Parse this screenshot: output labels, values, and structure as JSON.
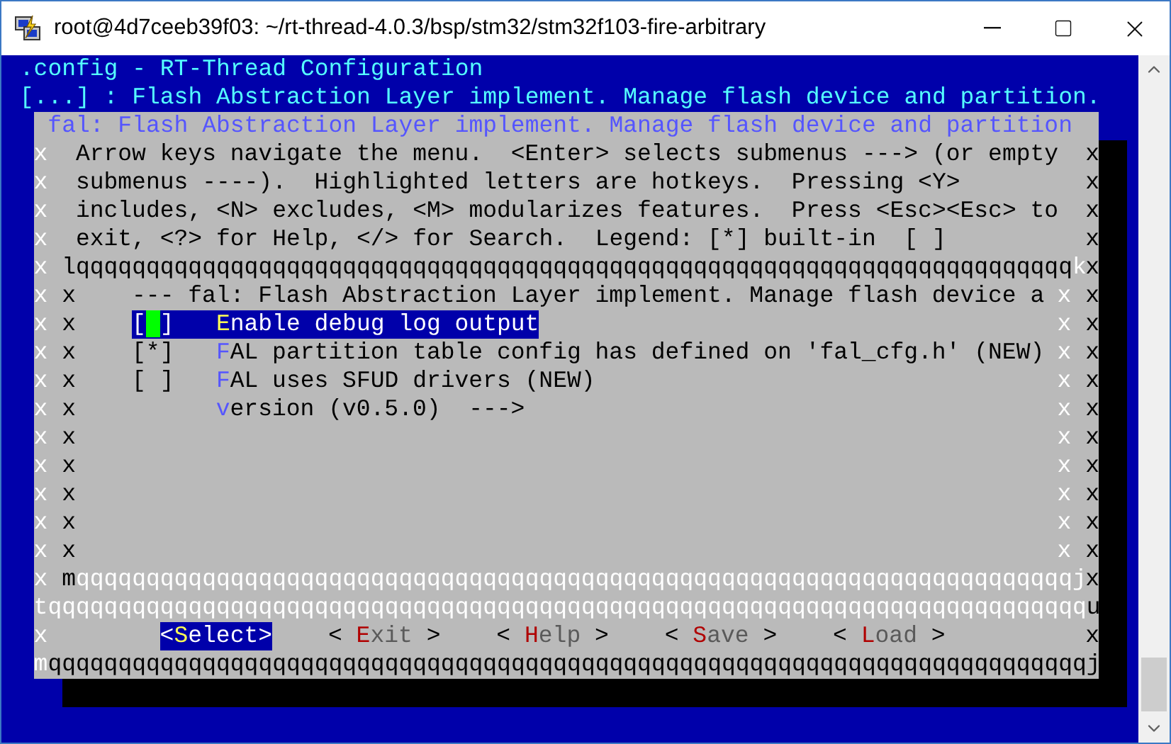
{
  "window": {
    "title": "root@4d7ceeb39f03: ~/rt-thread-4.0.3/bsp/stm32/stm32f103-fire-arbitrary"
  },
  "terminal": {
    "header": ".config - RT-Thread Configuration",
    "breadcrumb": "[...] : Flash Abstraction Layer implement. Manage flash device and partition.",
    "dialog": {
      "title": "fal: Flash Abstraction Layer implement. Manage flash device and partition",
      "help": [
        {
          "edge_left": "x",
          "text": "Arrow keys navigate the menu.  <Enter> selects submenus ---> (or empty",
          "edge_right": "x"
        },
        {
          "edge_left": "x",
          "text": "submenus ----).  Highlighted letters are hotkeys.  Pressing <Y>",
          "edge_right": "x"
        },
        {
          "edge_left": "x",
          "text": "includes, <N> excludes, <M> modularizes features.  Press <Esc><Esc> to",
          "edge_right": "x"
        },
        {
          "edge_left": "x",
          "text": "exit, <?> for Help, </> for Search.  Legend: [*] built-in  [ ]",
          "edge_right": "x"
        }
      ],
      "menu": {
        "top": {
          "edge_left": "x",
          "line": "lqqqqqqqqqqqqqqqqqqqqqqqqqqqqqqqqqqqqqqqqqqqqqqqqqqqqqqqqqqqqqqqqqqqqqqqk",
          "edge_right": "x"
        },
        "rows": [
          {
            "edges": [
              "x",
              "x",
              "x",
              "x"
            ],
            "kind": "comment",
            "text": "--- fal: Flash Abstraction Layer implement. Manage flash device a"
          },
          {
            "edges": [
              "x",
              "x",
              "x",
              "x"
            ],
            "kind": "option",
            "marker": "[ ]",
            "hotkey": "E",
            "rest": "nable debug log output",
            "selected": true,
            "cursor": true
          },
          {
            "edges": [
              "x",
              "x",
              "x",
              "x"
            ],
            "kind": "option",
            "marker": "[*]",
            "hotkey": "F",
            "rest": "AL partition table config has defined on 'fal_cfg.h' (NEW)",
            "selected": false,
            "cursor": false
          },
          {
            "edges": [
              "x",
              "x",
              "x",
              "x"
            ],
            "kind": "option",
            "marker": "[ ]",
            "hotkey": "F",
            "rest": "AL uses SFUD drivers (NEW)",
            "selected": false,
            "cursor": false
          },
          {
            "edges": [
              "x",
              "x",
              "x",
              "x"
            ],
            "kind": "submenu",
            "hotkey": "v",
            "rest": "ersion (v0.5.0)  --->",
            "selected": false
          },
          {
            "edges": [
              "x",
              "x",
              "x",
              "x"
            ],
            "kind": "blank"
          },
          {
            "edges": [
              "x",
              "x",
              "x",
              "x"
            ],
            "kind": "blank"
          },
          {
            "edges": [
              "x",
              "x",
              "x",
              "x"
            ],
            "kind": "blank"
          },
          {
            "edges": [
              "x",
              "x",
              "x",
              "x"
            ],
            "kind": "blank"
          },
          {
            "edges": [
              "x",
              "x",
              "x",
              "x"
            ],
            "kind": "blank"
          }
        ],
        "bottom": {
          "edge_left": "x",
          "line": "mqqqqqqqqqqqqqqqqqqqqqqqqqqqqqqqqqqqqqqqqqqqqqqqqqqqqqqqqqqqqqqqqqqqqqqqj",
          "edge_right": "x"
        }
      },
      "separator": "tqqqqqqqqqqqqqqqqqqqqqqqqqqqqqqqqqqqqqqqqqqqqqqqqqqqqqqqqqqqqqqqqqqqqqqqqqqu",
      "button_row": {
        "edge_left": "x",
        "edge_right": "x",
        "buttons": [
          {
            "open": "<",
            "hotkey": "S",
            "rest": "elect",
            "close": ">",
            "selected": true
          },
          {
            "open": "< ",
            "hotkey": "E",
            "rest": "xit",
            "close": " >",
            "selected": false
          },
          {
            "open": "< ",
            "hotkey": "H",
            "rest": "elp",
            "close": " >",
            "selected": false
          },
          {
            "open": "< ",
            "hotkey": "S",
            "rest": "ave",
            "close": " >",
            "selected": false
          },
          {
            "open": "< ",
            "hotkey": "L",
            "rest": "oad",
            "close": " >",
            "selected": false
          }
        ]
      },
      "bottom": "mqqqqqqqqqqqqqqqqqqqqqqqqqqqqqqqqqqqqqqqqqqqqqqqqqqqqqqqqqqqqqqqqqqqqqqqqqqj"
    }
  }
}
